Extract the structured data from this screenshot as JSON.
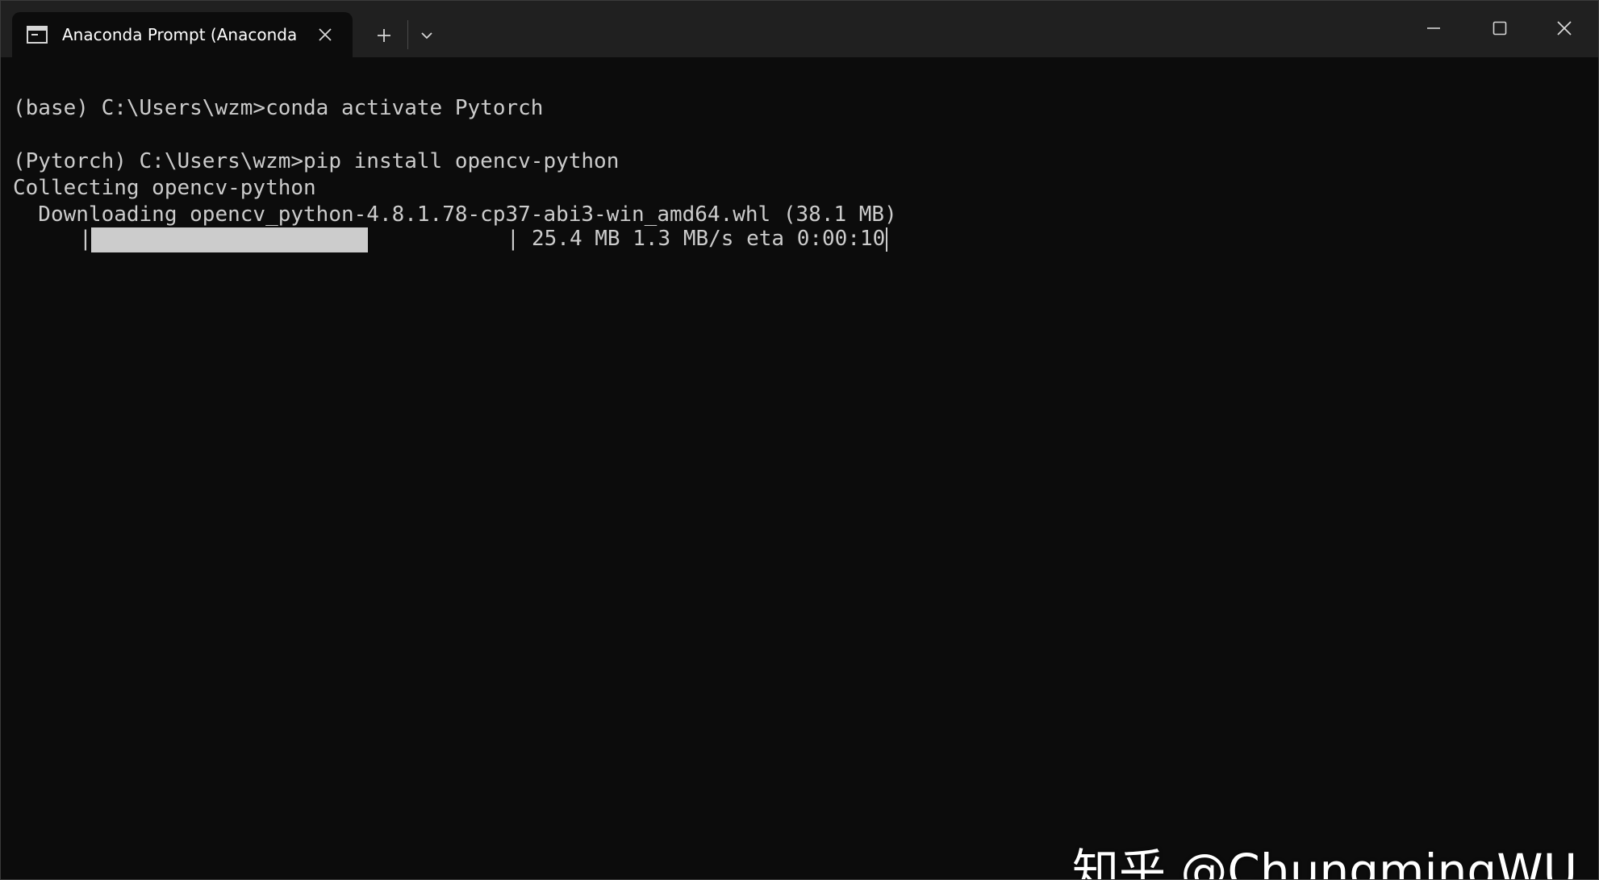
{
  "window": {
    "tab_title": "Anaconda Prompt (Anaconda",
    "icons": {
      "tab": "terminal-icon",
      "tab_close": "close-icon",
      "new_tab": "plus-icon",
      "dropdown": "chevron-down-icon",
      "minimize": "minimize-icon",
      "maximize": "maximize-icon",
      "close": "close-icon"
    },
    "colors": {
      "titlebar": "#202020",
      "terminal_bg": "#0c0c0c",
      "terminal_fg": "#cccccc"
    }
  },
  "terminal": {
    "lines": [
      "(base) C:\\Users\\wzm>conda activate Pytorch",
      "",
      "(Pytorch) C:\\Users\\wzm>pip install opencv-python",
      "Collecting opencv-python",
      "  Downloading opencv_python-4.8.1.78-cp37-abi3-win_amd64.whl (38.1 MB)"
    ],
    "progress": {
      "left_bar": "|",
      "right_bar": "|",
      "fraction": 0.6667,
      "stats": "25.4 MB 1.3 MB/s eta 0:00:10"
    }
  },
  "watermark": "知乎 @ChungmingWU"
}
